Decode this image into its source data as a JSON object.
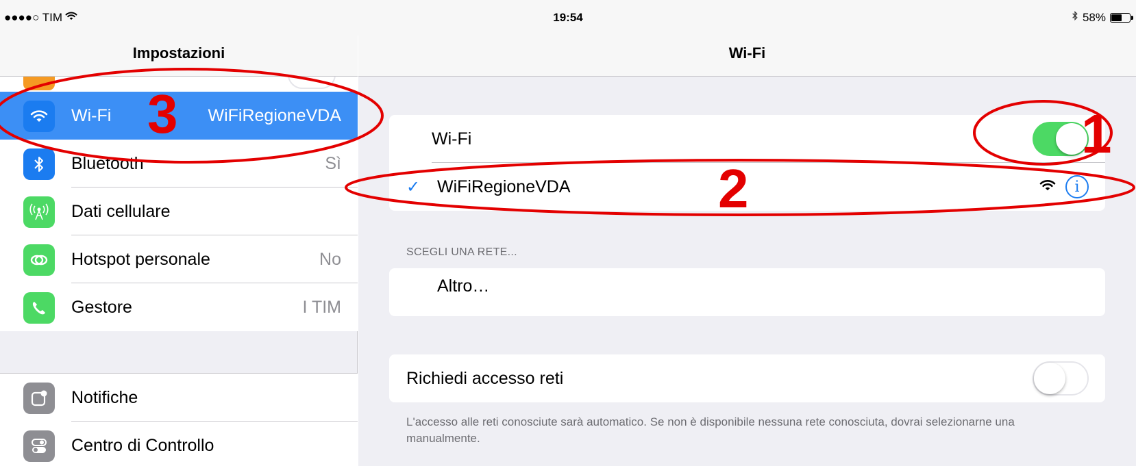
{
  "status_bar": {
    "carrier": "●●●●○ TIM",
    "time": "19:54",
    "battery_percent": "58%",
    "battery_level": 0.58
  },
  "sidebar": {
    "title": "Impostazioni",
    "items": [
      {
        "label": "Wi-Fi",
        "value": "WiFiRegioneVDA",
        "icon": "wifi-icon",
        "color": "#1b7cf0",
        "selected": true
      },
      {
        "label": "Bluetooth",
        "value": "Sì",
        "icon": "bluetooth-icon",
        "color": "#1b7cf0"
      },
      {
        "label": "Dati cellulare",
        "value": "",
        "icon": "antenna-icon",
        "color": "#4cd964"
      },
      {
        "label": "Hotspot personale",
        "value": "No",
        "icon": "link-icon",
        "color": "#4cd964"
      },
      {
        "label": "Gestore",
        "value": "I TIM",
        "icon": "phone-icon",
        "color": "#4cd964"
      },
      {
        "label": "Notifiche",
        "value": "",
        "icon": "notification-icon",
        "color": "#8e8e93"
      },
      {
        "label": "Centro di Controllo",
        "value": "",
        "icon": "toggles-icon",
        "color": "#8e8e93"
      }
    ]
  },
  "main": {
    "title": "Wi-Fi",
    "wifi_toggle_label": "Wi-Fi",
    "wifi_enabled": true,
    "connected_network": "WiFiRegioneVDA",
    "section_title": "SCEGLI UNA RETE...",
    "other_label": "Altro…",
    "ask_join_label": "Richiedi accesso reti",
    "ask_join_enabled": false,
    "ask_join_footer": "L'accesso alle reti conosciute sarà automatico. Se non è disponibile nessuna rete conosciuta, dovrai selezionarne una manualmente."
  },
  "annotations": {
    "step1": "1",
    "step2": "2",
    "step3": "3",
    "color": "#e30000"
  }
}
